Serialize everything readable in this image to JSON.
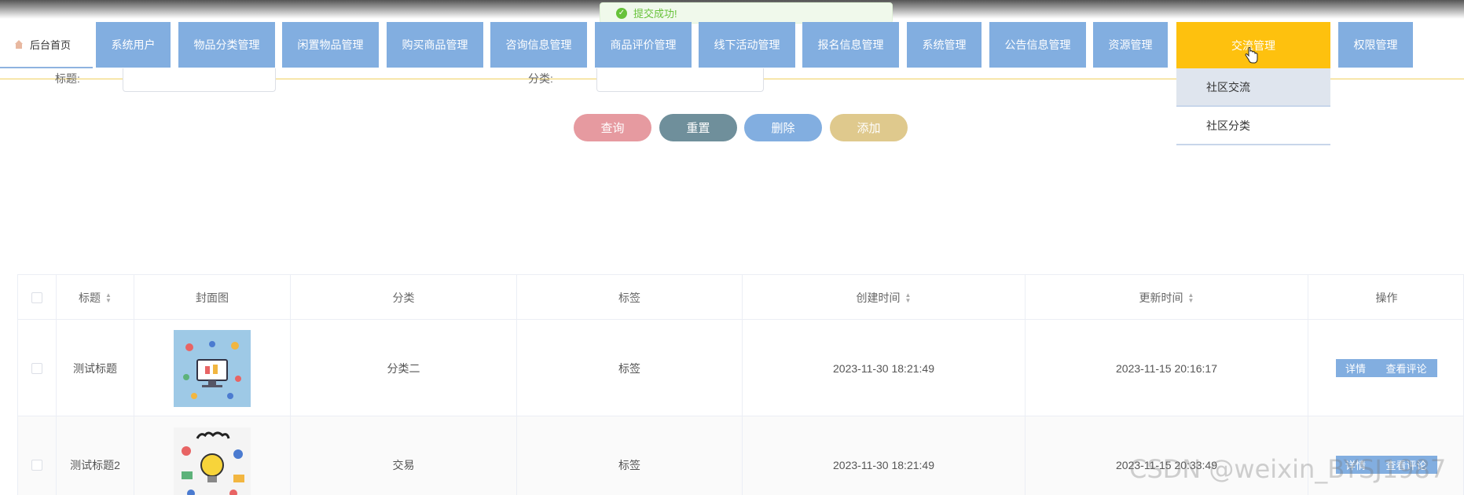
{
  "toast": {
    "message": "提交成功!"
  },
  "nav": {
    "home_label": "后台首页",
    "items": [
      "系统用户",
      "物品分类管理",
      "闲置物品管理",
      "购买商品管理",
      "咨询信息管理",
      "商品评价管理",
      "线下活动管理",
      "报名信息管理",
      "系统管理",
      "公告信息管理",
      "资源管理",
      "交流管理",
      "权限管理"
    ],
    "active": "交流管理",
    "dropdown": [
      "社区交流",
      "社区分类"
    ]
  },
  "search": {
    "label_title": "标题:",
    "label_category": "分类:"
  },
  "buttons": {
    "query": "查询",
    "reset": "重置",
    "delete": "删除",
    "add": "添加",
    "query_color": "#e69aa0",
    "reset_color": "#6f8f9b",
    "delete_color": "#82aee0",
    "add_color": "#dfc98d"
  },
  "table": {
    "headers": [
      "标题",
      "封面图",
      "分类",
      "标签",
      "创建时间",
      "更新时间",
      "操作"
    ],
    "rows": [
      {
        "title": "测试标题",
        "category": "分类二",
        "tag": "标签",
        "created": "2023-11-30 18:21:49",
        "updated": "2023-11-15 20:16:17",
        "op_detail": "详情",
        "op_comment": "查看评论"
      },
      {
        "title": "测试标题2",
        "category": "交易",
        "tag": "标签",
        "created": "2023-11-30 18:21:49",
        "updated": "2023-11-15 20:33:49",
        "op_detail": "详情",
        "op_comment": "查看评论"
      }
    ]
  },
  "watermark": "CSDN @weixin_BYSJ1987",
  "colors": {
    "nav": "#82aee0",
    "nav_active": "#fec10e",
    "toast": "#67c23a"
  }
}
